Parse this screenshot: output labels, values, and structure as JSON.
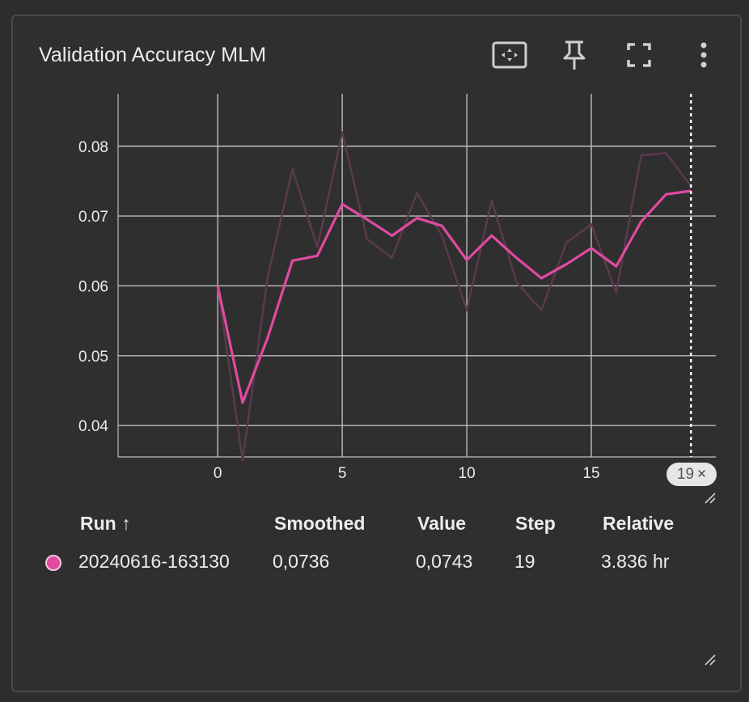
{
  "card": {
    "title": "Validation Accuracy MLM",
    "toolbar_icons": [
      "fit-domain-icon",
      "pin-icon",
      "fullscreen-icon",
      "more-vert-icon"
    ]
  },
  "colors": {
    "run": "#e04aa0",
    "raw_line": "#5a3a4e",
    "grid": "#bdbdbd",
    "background": "#2f2f2f"
  },
  "chart_data": {
    "type": "line",
    "title": "Validation Accuracy MLM",
    "xlabel": "",
    "ylabel": "",
    "xlim": [
      -4,
      20
    ],
    "ylim": [
      0.0355,
      0.0875
    ],
    "x_ticks": [
      0,
      5,
      10,
      15
    ],
    "y_ticks": [
      0.04,
      0.05,
      0.06,
      0.07,
      0.08
    ],
    "x_tick_labels": [
      "0",
      "5",
      "10",
      "15"
    ],
    "y_tick_labels": [
      "0.04",
      "0.05",
      "0.06",
      "0.07",
      "0.08"
    ],
    "grid": true,
    "cursor_step": 19,
    "x": [
      0,
      1,
      2,
      3,
      4,
      5,
      6,
      7,
      8,
      9,
      10,
      11,
      12,
      13,
      14,
      15,
      16,
      17,
      18,
      19
    ],
    "series": [
      {
        "name": "20240616-163130",
        "role": "smoothed",
        "values": [
          0.06,
          0.0433,
          0.0525,
          0.0636,
          0.0643,
          0.0717,
          0.0695,
          0.0672,
          0.0697,
          0.0686,
          0.0637,
          0.0672,
          0.064,
          0.0611,
          0.0631,
          0.0654,
          0.0628,
          0.0692,
          0.0731,
          0.0736
        ]
      },
      {
        "name": "20240616-163130",
        "role": "value",
        "values": [
          0.06,
          0.035,
          0.0612,
          0.0767,
          0.0655,
          0.082,
          0.0667,
          0.064,
          0.0733,
          0.0672,
          0.0565,
          0.0722,
          0.0605,
          0.0565,
          0.0662,
          0.0688,
          0.059,
          0.0787,
          0.079,
          0.0743
        ]
      }
    ]
  },
  "cursor_chip": {
    "label": "19",
    "close": "×"
  },
  "table": {
    "headers": {
      "run": "Run ↑",
      "smoothed": "Smoothed",
      "value": "Value",
      "step": "Step",
      "relative": "Relative"
    },
    "rows": [
      {
        "run": "20240616-163130",
        "smoothed": "0,0736",
        "value": "0,0743",
        "step": "19",
        "relative": "3.836 hr"
      }
    ]
  }
}
